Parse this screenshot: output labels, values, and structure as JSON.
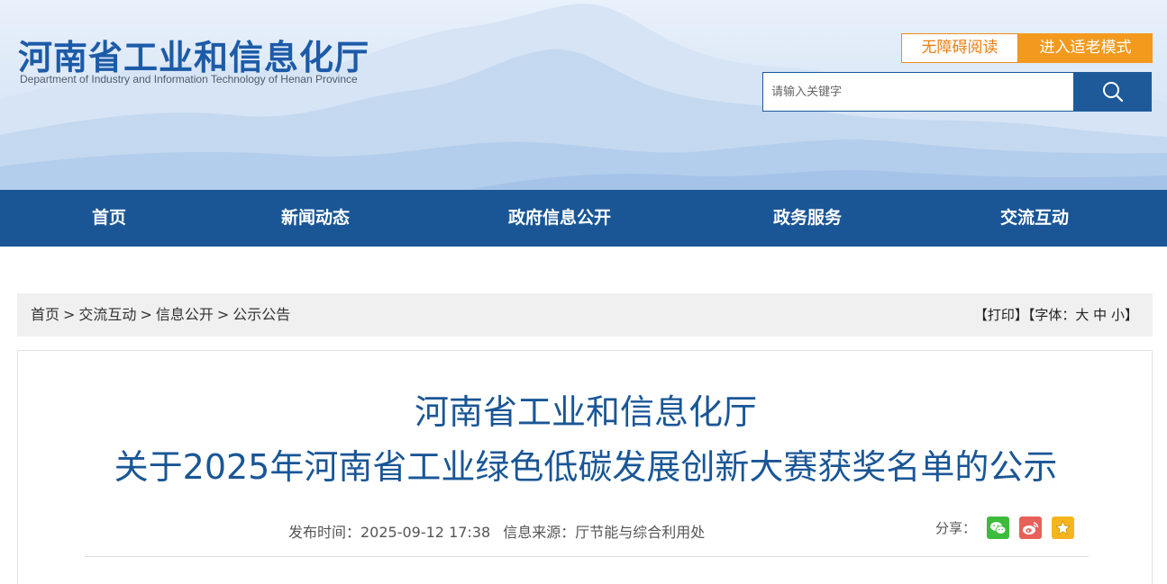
{
  "header": {
    "logo_cn": "河南省工业和信息化厅",
    "logo_en": "Department of Industry and Information Technology of Henan Province",
    "accessibility_label": "无障碍阅读",
    "elder_mode_label": "进入适老模式",
    "search": {
      "placeholder": "请输入关键字"
    }
  },
  "nav": {
    "items": [
      {
        "label": "首页"
      },
      {
        "label": "新闻动态"
      },
      {
        "label": "政府信息公开"
      },
      {
        "label": "政务服务"
      },
      {
        "label": "交流互动"
      }
    ]
  },
  "breadcrumb": {
    "items": [
      "首页",
      "交流互动",
      "信息公开",
      "公示公告"
    ],
    "separator": ">"
  },
  "tools": {
    "print_label": "【打印】",
    "font_prefix": "【字体：",
    "font_large": "大",
    "font_medium": "中",
    "font_small": "小",
    "font_suffix": "】"
  },
  "article": {
    "title_line1": "河南省工业和信息化厅",
    "title_line2": "关于2025年河南省工业绿色低碳发展创新大赛获奖名单的公示",
    "publish_time": "发布时间：2025-09-12 17:38",
    "source": "信息来源：厅节能与综合利用处",
    "share_label": "分享："
  },
  "colors": {
    "brand_blue": "#1a5696",
    "accent_orange": "#f39a1e",
    "wechat_green": "#3dbb3d",
    "weibo_red": "#e8605a",
    "favorite_yellow": "#f5b51e"
  },
  "icons": [
    "search-icon",
    "wechat-icon",
    "weibo-icon",
    "star-icon"
  ]
}
